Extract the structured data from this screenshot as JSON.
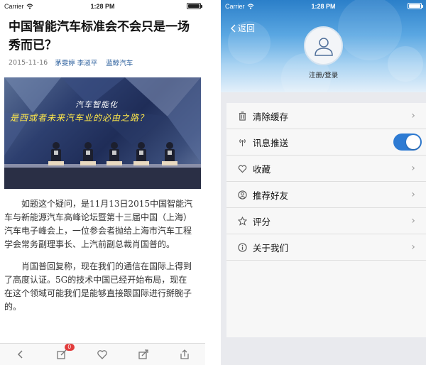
{
  "left": {
    "status": {
      "carrier": "Carrier",
      "time": "1:28 PM"
    },
    "title": "中国智能汽车标准会不会只是一场秀而已？",
    "date": "2015-11-16",
    "authors": "茅雯婷 李淑平",
    "source": "蓝鲸汽车",
    "image": {
      "banner_line1": "汽车智能化",
      "banner_line2": "是西或者未来汽车业的必由之路？"
    },
    "paragraphs": [
      "如题这个疑问，是11月13日2015中国智能汽车与新能源汽车高峰论坛暨第十三届中国（上海）汽车电子峰会上，一位参会者抛给上海市汽车工程学会常务副理事长、上汽前副总裁肖国普的。",
      "肖国普回复称，现在我们的通信在国际上得到了高度认证。5G的技术中国已经开始布局，现在在这个领域可能我们是能够直接跟国际进行掰腕子的。"
    ],
    "toolbar": {
      "comment_count": "0"
    }
  },
  "right": {
    "status": {
      "carrier": "Carrier",
      "time": "1:28 PM"
    },
    "back_label": "返回",
    "login_label": "注册/登录",
    "menu": [
      {
        "label": "清除缓存",
        "icon": "trash-icon"
      },
      {
        "label": "讯息推送",
        "icon": "broadcast-icon",
        "toggle": "on"
      },
      {
        "label": "收藏",
        "icon": "heart-icon"
      },
      {
        "label": "推荐好友",
        "icon": "person-icon"
      },
      {
        "label": "评分",
        "icon": "star-icon"
      },
      {
        "label": "关于我们",
        "icon": "info-icon"
      }
    ],
    "toggle_color": "#2e7bd3"
  }
}
